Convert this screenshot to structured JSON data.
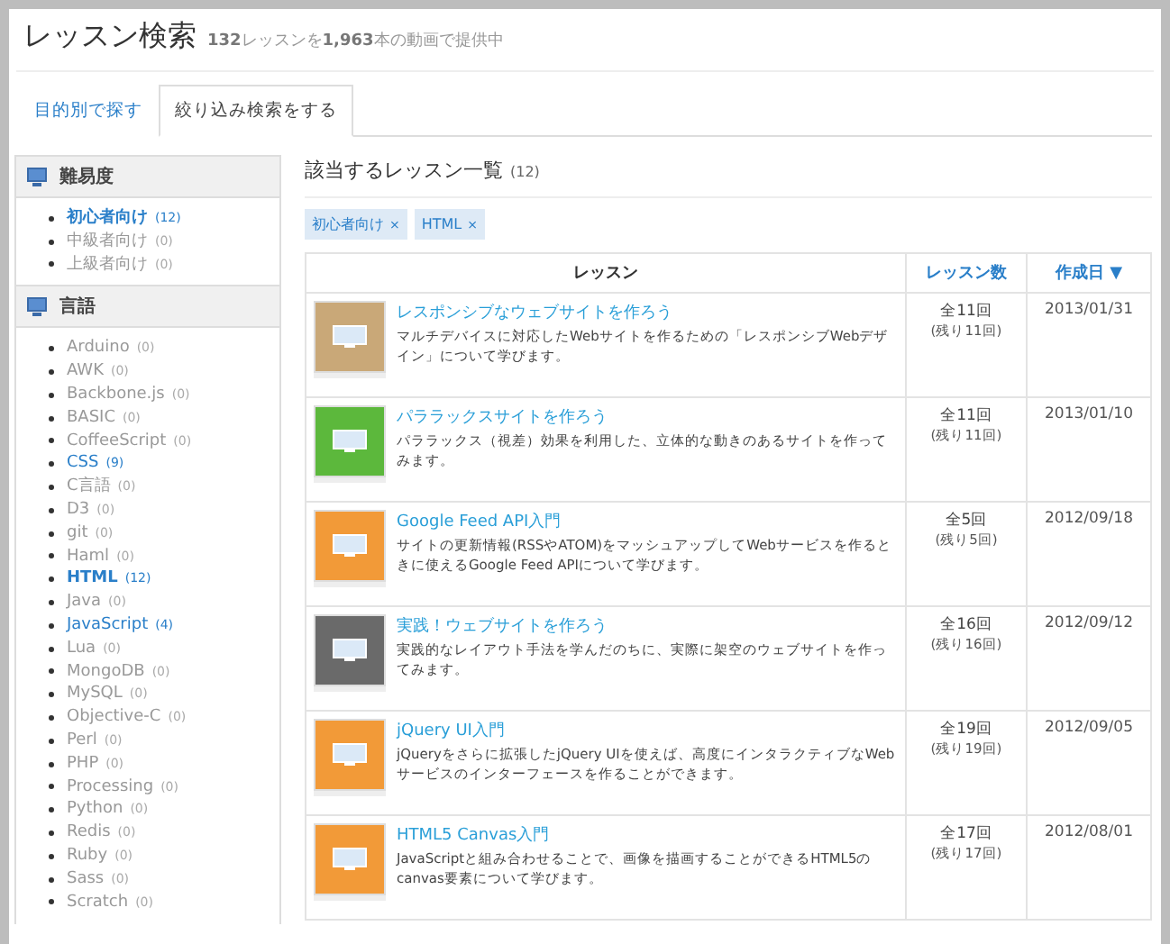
{
  "header": {
    "title": "レッスン検索",
    "subtitle": "**132**レッスンを**1,963**本の動画で提供中"
  },
  "tabs": [
    {
      "label": "目的別で探す",
      "selected": false
    },
    {
      "label": "絞り込み検索をする",
      "selected": true
    }
  ],
  "sidebar": {
    "sections": [
      {
        "title": "難易度",
        "items": [
          {
            "label": "初心者向け",
            "count": "(12)",
            "selected": true,
            "disabled": false
          },
          {
            "label": "中級者向け",
            "count": "(0)",
            "selected": false,
            "disabled": true
          },
          {
            "label": "上級者向け",
            "count": "(0)",
            "selected": false,
            "disabled": true
          }
        ]
      },
      {
        "title": "言語",
        "items": [
          {
            "label": "Arduino",
            "count": "(0)",
            "selected": false,
            "disabled": true
          },
          {
            "label": "AWK",
            "count": "(0)",
            "selected": false,
            "disabled": true
          },
          {
            "label": "Backbone.js",
            "count": "(0)",
            "selected": false,
            "disabled": true
          },
          {
            "label": "BASIC",
            "count": "(0)",
            "selected": false,
            "disabled": true
          },
          {
            "label": "CoffeeScript",
            "count": "(0)",
            "selected": false,
            "disabled": true
          },
          {
            "label": "CSS",
            "count": "(9)",
            "selected": false,
            "disabled": false
          },
          {
            "label": "C言語",
            "count": "(0)",
            "selected": false,
            "disabled": true
          },
          {
            "label": "D3",
            "count": "(0)",
            "selected": false,
            "disabled": true
          },
          {
            "label": "git",
            "count": "(0)",
            "selected": false,
            "disabled": true
          },
          {
            "label": "Haml",
            "count": "(0)",
            "selected": false,
            "disabled": true
          },
          {
            "label": "HTML",
            "count": "(12)",
            "selected": true,
            "disabled": false
          },
          {
            "label": "Java",
            "count": "(0)",
            "selected": false,
            "disabled": true
          },
          {
            "label": "JavaScript",
            "count": "(4)",
            "selected": false,
            "disabled": false
          },
          {
            "label": "Lua",
            "count": "(0)",
            "selected": false,
            "disabled": true
          },
          {
            "label": "MongoDB",
            "count": "(0)",
            "selected": false,
            "disabled": true
          },
          {
            "label": "MySQL",
            "count": "(0)",
            "selected": false,
            "disabled": true
          },
          {
            "label": "Objective-C",
            "count": "(0)",
            "selected": false,
            "disabled": true
          },
          {
            "label": "Perl",
            "count": "(0)",
            "selected": false,
            "disabled": true
          },
          {
            "label": "PHP",
            "count": "(0)",
            "selected": false,
            "disabled": true
          },
          {
            "label": "Processing",
            "count": "(0)",
            "selected": false,
            "disabled": true
          },
          {
            "label": "Python",
            "count": "(0)",
            "selected": false,
            "disabled": true
          },
          {
            "label": "Redis",
            "count": "(0)",
            "selected": false,
            "disabled": true
          },
          {
            "label": "Ruby",
            "count": "(0)",
            "selected": false,
            "disabled": true
          },
          {
            "label": "Sass",
            "count": "(0)",
            "selected": false,
            "disabled": true
          },
          {
            "label": "Scratch",
            "count": "(0)",
            "selected": false,
            "disabled": true
          }
        ]
      }
    ]
  },
  "results": {
    "title": "該当するレッスン一覧",
    "count": "(12)",
    "filters": [
      {
        "label": "初心者向け",
        "remove": "×"
      },
      {
        "label": "HTML",
        "remove": "×"
      }
    ],
    "table": {
      "columns": [
        {
          "label": "レッスン",
          "kind": "plain"
        },
        {
          "label": "レッスン数",
          "kind": "link"
        },
        {
          "label": "作成日",
          "kind": "sorted",
          "arrow": "▼"
        }
      ],
      "rows": [
        {
          "color": "#c9a878",
          "title": "レスポンシブなウェブサイトを作ろう",
          "description": "マルチデバイスに対応したWebサイトを作るための「レスポンシブWebデザイン」について学びます。",
          "total": "全11回",
          "remaining": "(残り11回)",
          "date": "2013/01/31"
        },
        {
          "color": "#5cb83c",
          "title": "パララックスサイトを作ろう",
          "description": "パララックス（視差）効果を利用した、立体的な動きのあるサイトを作ってみます。",
          "total": "全11回",
          "remaining": "(残り11回)",
          "date": "2013/01/10"
        },
        {
          "color": "#f29a38",
          "title": "Google Feed API入門",
          "description": "サイトの更新情報(RSSやATOM)をマッシュアップしてWebサービスを作るときに使えるGoogle Feed APIについて学びます。",
          "total": "全5回",
          "remaining": "(残り5回)",
          "date": "2012/09/18"
        },
        {
          "color": "#6a6a6a",
          "title": "実践！ウェブサイトを作ろう",
          "description": "実践的なレイアウト手法を学んだのちに、実際に架空のウェブサイトを作ってみます。",
          "total": "全16回",
          "remaining": "(残り16回)",
          "date": "2012/09/12"
        },
        {
          "color": "#f29a38",
          "title": "jQuery UI入門",
          "description": "jQueryをさらに拡張したjQuery UIを使えば、高度にインタラクティブなWebサービスのインターフェースを作ることができます。",
          "total": "全19回",
          "remaining": "(残り19回)",
          "date": "2012/09/05"
        },
        {
          "color": "#f29a38",
          "title": "HTML5 Canvas入門",
          "description": "JavaScriptと組み合わせることで、画像を描画することができるHTML5のcanvas要素について学びます。",
          "total": "全17回",
          "remaining": "(残り17回)",
          "date": "2012/08/01"
        }
      ]
    }
  }
}
